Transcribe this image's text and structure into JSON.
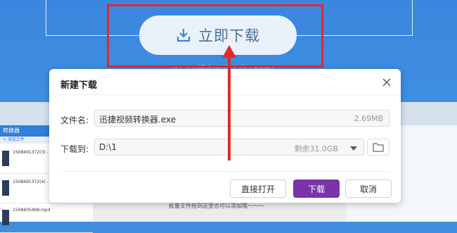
{
  "hero": {
    "download_label": "立即下载",
    "version_note": "(V1.4.0版本/软件大小2.68M)"
  },
  "dialog": {
    "title": "新建下载",
    "filename_label": "文件名:",
    "filename_value": "迅捷视频转换器.exe",
    "filename_size": "2.69MB",
    "path_label": "下载到:",
    "path_value": "D:\\1",
    "path_free": "剩余31.0GB",
    "open_label": "直接打开",
    "download_label": "下载",
    "cancel_label": "取消"
  },
  "background_app": {
    "header": "转换器",
    "toolbar": "+ 添加文件",
    "files": [
      {
        "name": "1508491372(3) - 副本.wmv"
      },
      {
        "name": "1508491372(4) - 副本.wmv"
      },
      {
        "name": "1508405468.mp4"
      }
    ],
    "hint": "批量文件拖到这里也可以添加哦～～～"
  },
  "colors": {
    "accent_purple": "#7a34a8",
    "annotation_red": "#e02a2a",
    "hero_blue": "#3f8ee0"
  }
}
